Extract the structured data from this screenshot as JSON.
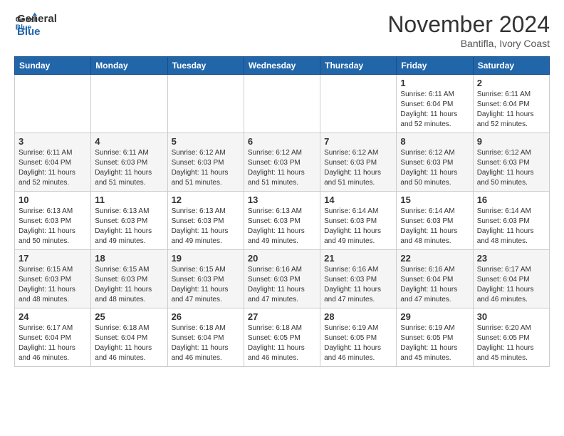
{
  "header": {
    "logo_general": "General",
    "logo_blue": "Blue",
    "month_title": "November 2024",
    "location": "Bantifla, Ivory Coast"
  },
  "weekdays": [
    "Sunday",
    "Monday",
    "Tuesday",
    "Wednesday",
    "Thursday",
    "Friday",
    "Saturday"
  ],
  "weeks": [
    [
      {
        "day": "",
        "info": ""
      },
      {
        "day": "",
        "info": ""
      },
      {
        "day": "",
        "info": ""
      },
      {
        "day": "",
        "info": ""
      },
      {
        "day": "",
        "info": ""
      },
      {
        "day": "1",
        "info": "Sunrise: 6:11 AM\nSunset: 6:04 PM\nDaylight: 11 hours\nand 52 minutes."
      },
      {
        "day": "2",
        "info": "Sunrise: 6:11 AM\nSunset: 6:04 PM\nDaylight: 11 hours\nand 52 minutes."
      }
    ],
    [
      {
        "day": "3",
        "info": "Sunrise: 6:11 AM\nSunset: 6:04 PM\nDaylight: 11 hours\nand 52 minutes."
      },
      {
        "day": "4",
        "info": "Sunrise: 6:11 AM\nSunset: 6:03 PM\nDaylight: 11 hours\nand 51 minutes."
      },
      {
        "day": "5",
        "info": "Sunrise: 6:12 AM\nSunset: 6:03 PM\nDaylight: 11 hours\nand 51 minutes."
      },
      {
        "day": "6",
        "info": "Sunrise: 6:12 AM\nSunset: 6:03 PM\nDaylight: 11 hours\nand 51 minutes."
      },
      {
        "day": "7",
        "info": "Sunrise: 6:12 AM\nSunset: 6:03 PM\nDaylight: 11 hours\nand 51 minutes."
      },
      {
        "day": "8",
        "info": "Sunrise: 6:12 AM\nSunset: 6:03 PM\nDaylight: 11 hours\nand 50 minutes."
      },
      {
        "day": "9",
        "info": "Sunrise: 6:12 AM\nSunset: 6:03 PM\nDaylight: 11 hours\nand 50 minutes."
      }
    ],
    [
      {
        "day": "10",
        "info": "Sunrise: 6:13 AM\nSunset: 6:03 PM\nDaylight: 11 hours\nand 50 minutes."
      },
      {
        "day": "11",
        "info": "Sunrise: 6:13 AM\nSunset: 6:03 PM\nDaylight: 11 hours\nand 49 minutes."
      },
      {
        "day": "12",
        "info": "Sunrise: 6:13 AM\nSunset: 6:03 PM\nDaylight: 11 hours\nand 49 minutes."
      },
      {
        "day": "13",
        "info": "Sunrise: 6:13 AM\nSunset: 6:03 PM\nDaylight: 11 hours\nand 49 minutes."
      },
      {
        "day": "14",
        "info": "Sunrise: 6:14 AM\nSunset: 6:03 PM\nDaylight: 11 hours\nand 49 minutes."
      },
      {
        "day": "15",
        "info": "Sunrise: 6:14 AM\nSunset: 6:03 PM\nDaylight: 11 hours\nand 48 minutes."
      },
      {
        "day": "16",
        "info": "Sunrise: 6:14 AM\nSunset: 6:03 PM\nDaylight: 11 hours\nand 48 minutes."
      }
    ],
    [
      {
        "day": "17",
        "info": "Sunrise: 6:15 AM\nSunset: 6:03 PM\nDaylight: 11 hours\nand 48 minutes."
      },
      {
        "day": "18",
        "info": "Sunrise: 6:15 AM\nSunset: 6:03 PM\nDaylight: 11 hours\nand 48 minutes."
      },
      {
        "day": "19",
        "info": "Sunrise: 6:15 AM\nSunset: 6:03 PM\nDaylight: 11 hours\nand 47 minutes."
      },
      {
        "day": "20",
        "info": "Sunrise: 6:16 AM\nSunset: 6:03 PM\nDaylight: 11 hours\nand 47 minutes."
      },
      {
        "day": "21",
        "info": "Sunrise: 6:16 AM\nSunset: 6:03 PM\nDaylight: 11 hours\nand 47 minutes."
      },
      {
        "day": "22",
        "info": "Sunrise: 6:16 AM\nSunset: 6:04 PM\nDaylight: 11 hours\nand 47 minutes."
      },
      {
        "day": "23",
        "info": "Sunrise: 6:17 AM\nSunset: 6:04 PM\nDaylight: 11 hours\nand 46 minutes."
      }
    ],
    [
      {
        "day": "24",
        "info": "Sunrise: 6:17 AM\nSunset: 6:04 PM\nDaylight: 11 hours\nand 46 minutes."
      },
      {
        "day": "25",
        "info": "Sunrise: 6:18 AM\nSunset: 6:04 PM\nDaylight: 11 hours\nand 46 minutes."
      },
      {
        "day": "26",
        "info": "Sunrise: 6:18 AM\nSunset: 6:04 PM\nDaylight: 11 hours\nand 46 minutes."
      },
      {
        "day": "27",
        "info": "Sunrise: 6:18 AM\nSunset: 6:05 PM\nDaylight: 11 hours\nand 46 minutes."
      },
      {
        "day": "28",
        "info": "Sunrise: 6:19 AM\nSunset: 6:05 PM\nDaylight: 11 hours\nand 46 minutes."
      },
      {
        "day": "29",
        "info": "Sunrise: 6:19 AM\nSunset: 6:05 PM\nDaylight: 11 hours\nand 45 minutes."
      },
      {
        "day": "30",
        "info": "Sunrise: 6:20 AM\nSunset: 6:05 PM\nDaylight: 11 hours\nand 45 minutes."
      }
    ]
  ]
}
